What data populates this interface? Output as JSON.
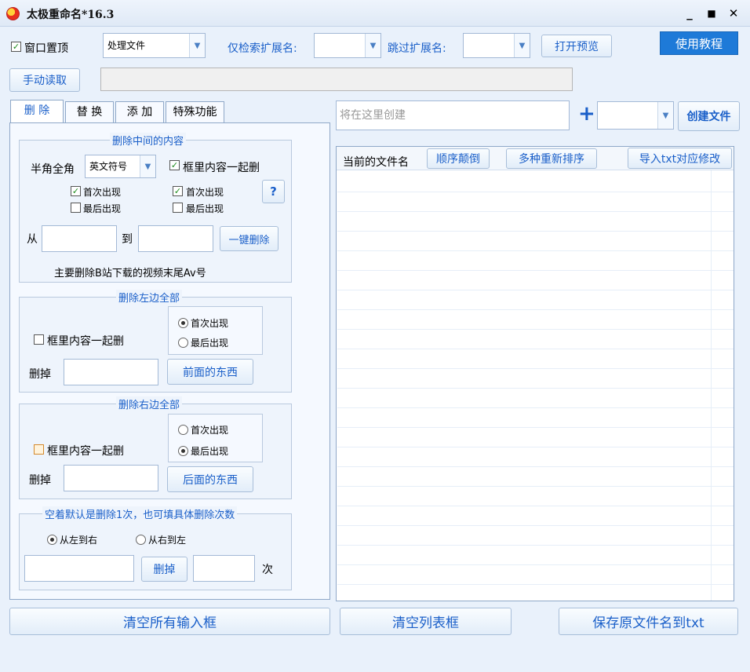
{
  "window": {
    "title": "太极重命名*16.3",
    "minimize": "_",
    "maximize": "■",
    "close": "✕"
  },
  "toolbar": {
    "topmost_label": "窗口置顶",
    "topmost_checked": true,
    "mode_value": "处理文件",
    "only_ext_label": "仅检索扩展名:",
    "only_ext_value": "",
    "skip_ext_label": "跳过扩展名:",
    "skip_ext_value": "",
    "preview_button": "打开预览",
    "tutorial_button": "使用教程",
    "manual_read_button": "手动读取",
    "path_value": ""
  },
  "tabs": [
    "删 除",
    "替 换",
    "添 加",
    "特殊功能"
  ],
  "delete_middle": {
    "title": "删除中间的内容",
    "width_label": "半角全角",
    "symbol_value": "英文符号",
    "include_content_label": "框里内容一起删",
    "left_first_label": "首次出现",
    "left_last_label": "最后出现",
    "right_first_label": "首次出现",
    "right_last_label": "最后出现",
    "help_button": "?",
    "from_label": "从",
    "to_label": "到",
    "from_value": "",
    "to_value": "",
    "one_click_button": "一键删除",
    "note": "主要删除B站下载的视频末尾Av号"
  },
  "delete_left": {
    "title": "删除左边全部",
    "include_content_label": "框里内容一起删",
    "first_label": "首次出现",
    "last_label": "最后出现",
    "delete_label": "删掉",
    "value": "",
    "button": "前面的东西"
  },
  "delete_right": {
    "title": "删除右边全部",
    "include_content_label": "框里内容一起删",
    "first_label": "首次出现",
    "last_label": "最后出现",
    "delete_label": "删掉",
    "value": "",
    "button": "后面的东西"
  },
  "delete_count": {
    "title": "空着默认是删除1次，也可填具体删除次数",
    "ltr_label": "从左到右",
    "rtl_label": "从右到左",
    "text_value": "",
    "delete_button": "删掉",
    "count_value": "",
    "times_label": "次"
  },
  "right_panel": {
    "create_placeholder": "将在这里创建",
    "plus": "+",
    "create_type_value": "",
    "create_button": "创建文件",
    "list_header": "当前的文件名",
    "reverse_button": "顺序颠倒",
    "resort_button": "多种重新排序",
    "import_button": "导入txt对应修改"
  },
  "bottom": {
    "clear_inputs": "清空所有输入框",
    "clear_list": "清空列表框",
    "save_names": "保存原文件名到txt"
  },
  "colors": {
    "accent": "#1a5fc9",
    "tutorial_bg": "#1e7ad8",
    "background": "#e9f1fb"
  }
}
